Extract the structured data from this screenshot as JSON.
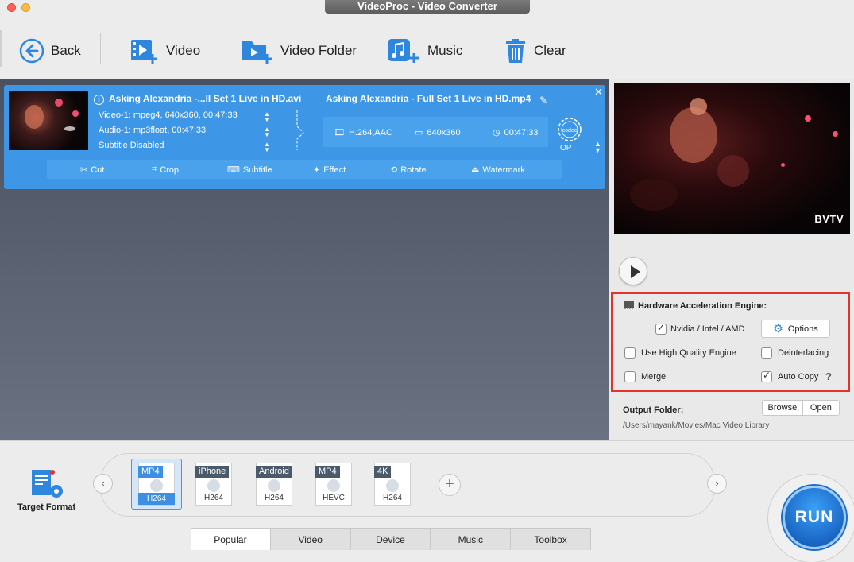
{
  "window": {
    "title": "VideoProc - Video Converter"
  },
  "toolbar": {
    "back": "Back",
    "video": "Video",
    "video_folder": "Video Folder",
    "music": "Music",
    "clear": "Clear",
    "accent": "#2f86de"
  },
  "task": {
    "source_title": "Asking Alexandria -...ll Set 1 Live in HD.avi",
    "video_track": "Video-1: mpeg4, 640x360, 00:47:33",
    "audio_track": "Audio-1: mp3float, 00:47:33",
    "subtitle": "Subtitle Disabled",
    "output_title": "Asking Alexandria - Full Set 1 Live in HD.mp4",
    "codec_info": "H.264,AAC",
    "resolution": "640x360",
    "duration": "00:47:33",
    "codec_badge": "codec",
    "opt_label": "OPT",
    "card_color": "#3d96e6",
    "edits": {
      "cut": "Cut",
      "crop": "Crop",
      "subtitle": "Subtitle",
      "effect": "Effect",
      "rotate": "Rotate",
      "watermark": "Watermark"
    }
  },
  "preview": {
    "logo": "BVTV"
  },
  "hardware": {
    "title": "Hardware Acceleration Engine:",
    "nvidia": {
      "label": "Nvidia / Intel / AMD",
      "checked": true
    },
    "options_label": "Options",
    "high_quality": {
      "label": "Use High Quality Engine",
      "checked": false
    },
    "deinterlacing": {
      "label": "Deinterlacing",
      "checked": false
    },
    "merge": {
      "label": "Merge",
      "checked": false
    },
    "auto_copy": {
      "label": "Auto Copy",
      "checked": true
    },
    "help": "?",
    "highlight_color": "#e5322d"
  },
  "output": {
    "label": "Output Folder:",
    "path": "/Users/mayank/Movies/Mac Video Library",
    "browse": "Browse",
    "open": "Open"
  },
  "formats": {
    "target_label": "Target Format",
    "items": [
      {
        "top": "MP4",
        "bottom": "H264"
      },
      {
        "top": "iPhone",
        "bottom": "H264"
      },
      {
        "top": "Android",
        "bottom": "H264"
      },
      {
        "top": "MP4",
        "bottom": "HEVC"
      },
      {
        "top": "4K",
        "bottom": "H264"
      }
    ],
    "selected_index": 0
  },
  "tabs": [
    "Popular",
    "Video",
    "Device",
    "Music",
    "Toolbox"
  ],
  "active_tab": "Popular",
  "run_label": "RUN"
}
